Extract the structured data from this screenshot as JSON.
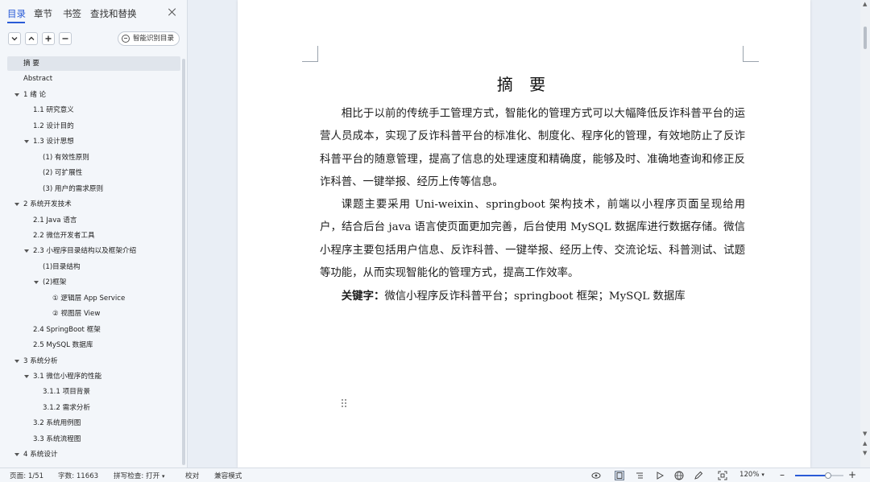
{
  "sidebar": {
    "tabs": [
      {
        "label": "目录",
        "active": true
      },
      {
        "label": "章节",
        "active": false
      },
      {
        "label": "书签",
        "active": false
      },
      {
        "label": "查找和替换",
        "active": false
      }
    ],
    "smart_toc_label": "智能识别目录",
    "toc": [
      {
        "label": "摘  要",
        "level": 0,
        "selected": true,
        "expander": false
      },
      {
        "label": "Abstract",
        "level": 0,
        "expander": false
      },
      {
        "label": "1 绪  论",
        "level": 0,
        "expander": true
      },
      {
        "label": "1.1 研究意义",
        "level": 1,
        "expander": false
      },
      {
        "label": "1.2 设计目的",
        "level": 1,
        "expander": false
      },
      {
        "label": "1.3 设计思想",
        "level": 1,
        "expander": true
      },
      {
        "label": "(1)  有效性原则",
        "level": 2,
        "expander": false
      },
      {
        "label": "(2)  可扩展性",
        "level": 2,
        "expander": false
      },
      {
        "label": "(3)  用户的需求原则",
        "level": 2,
        "expander": false
      },
      {
        "label": "2 系统开发技术",
        "level": 0,
        "expander": true
      },
      {
        "label": "2.1 Java 语言",
        "level": 1,
        "expander": false
      },
      {
        "label": "2.2 微信开发者工具",
        "level": 1,
        "expander": false
      },
      {
        "label": "2.3 小程序目录结构以及框架介绍",
        "level": 1,
        "expander": true
      },
      {
        "label": "(1)目录结构",
        "level": 2,
        "expander": false
      },
      {
        "label": "(2)框架",
        "level": 2,
        "expander": true
      },
      {
        "label": "①  逻辑层 App Service",
        "level": 3,
        "expander": false
      },
      {
        "label": "②  视图层 View",
        "level": 3,
        "expander": false
      },
      {
        "label": "2.4 SpringBoot 框架",
        "level": 1,
        "expander": false
      },
      {
        "label": "2.5 MySQL 数据库",
        "level": 1,
        "expander": false
      },
      {
        "label": "3 系统分析",
        "level": 0,
        "expander": true
      },
      {
        "label": "3.1 微信小程序的性能",
        "level": 1,
        "expander": true
      },
      {
        "label": "3.1.1 项目背景",
        "level": 2,
        "expander": false
      },
      {
        "label": "3.1.2 需求分析",
        "level": 2,
        "expander": false
      },
      {
        "label": "3.2 系统用例图",
        "level": 1,
        "expander": false
      },
      {
        "label": "3.3  系统流程图",
        "level": 1,
        "expander": false
      },
      {
        "label": "4  系统设计",
        "level": 0,
        "expander": true
      }
    ]
  },
  "document": {
    "title": "摘  要",
    "paragraphs": [
      "相比于以前的传统手工管理方式，智能化的管理方式可以大幅降低反诈科普平台的运营人员成本，实现了反诈科普平台的标准化、制度化、程序化的管理，有效地防止了反诈科普平台的随意管理，提高了信息的处理速度和精确度，能够及时、准确地查询和修正反诈科普、一键举报、经历上传等信息。",
      "课题主要采用 Uni-weixin、springboot 架构技术，前端以小程序页面呈现给用户，结合后台 java 语言使页面更加完善，后台使用 MySQL 数据库进行数据存储。微信小程序主要包括用户信息、反诈科普、一键举报、经历上传、交流论坛、科普测试、试题等功能，从而实现智能化的管理方式，提高工作效率。"
    ],
    "keywords_label": "关键字：",
    "keywords": "微信小程序反诈科普平台；springboot 框架；MySQL 数据库"
  },
  "statusbar": {
    "page": "页面: 1/51",
    "word_count": "字数: 11663",
    "spell_check": "拼写检查: 打开",
    "proofread": "校对",
    "compat_mode": "兼容模式",
    "zoom": "120%",
    "zoom_fraction": 0.68
  }
}
